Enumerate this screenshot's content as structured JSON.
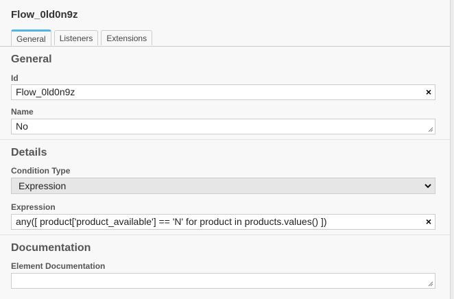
{
  "header": {
    "title": "Flow_0ld0n9z"
  },
  "tabs": [
    {
      "label": "General",
      "active": true
    },
    {
      "label": "Listeners",
      "active": false
    },
    {
      "label": "Extensions",
      "active": false
    }
  ],
  "general": {
    "heading": "General",
    "id_label": "Id",
    "id_value": "Flow_0ld0n9z",
    "name_label": "Name",
    "name_value": "No"
  },
  "details": {
    "heading": "Details",
    "condition_type_label": "Condition Type",
    "condition_type_value": "Expression",
    "expression_label": "Expression",
    "expression_value": "any([ product['product_available'] == 'N' for product in products.values() ])"
  },
  "documentation": {
    "heading": "Documentation",
    "element_doc_label": "Element Documentation",
    "element_doc_value": ""
  },
  "icons": {
    "clear": "×"
  },
  "colors": {
    "tab_accent": "#52b5e6",
    "background": "#f8f8f8"
  }
}
